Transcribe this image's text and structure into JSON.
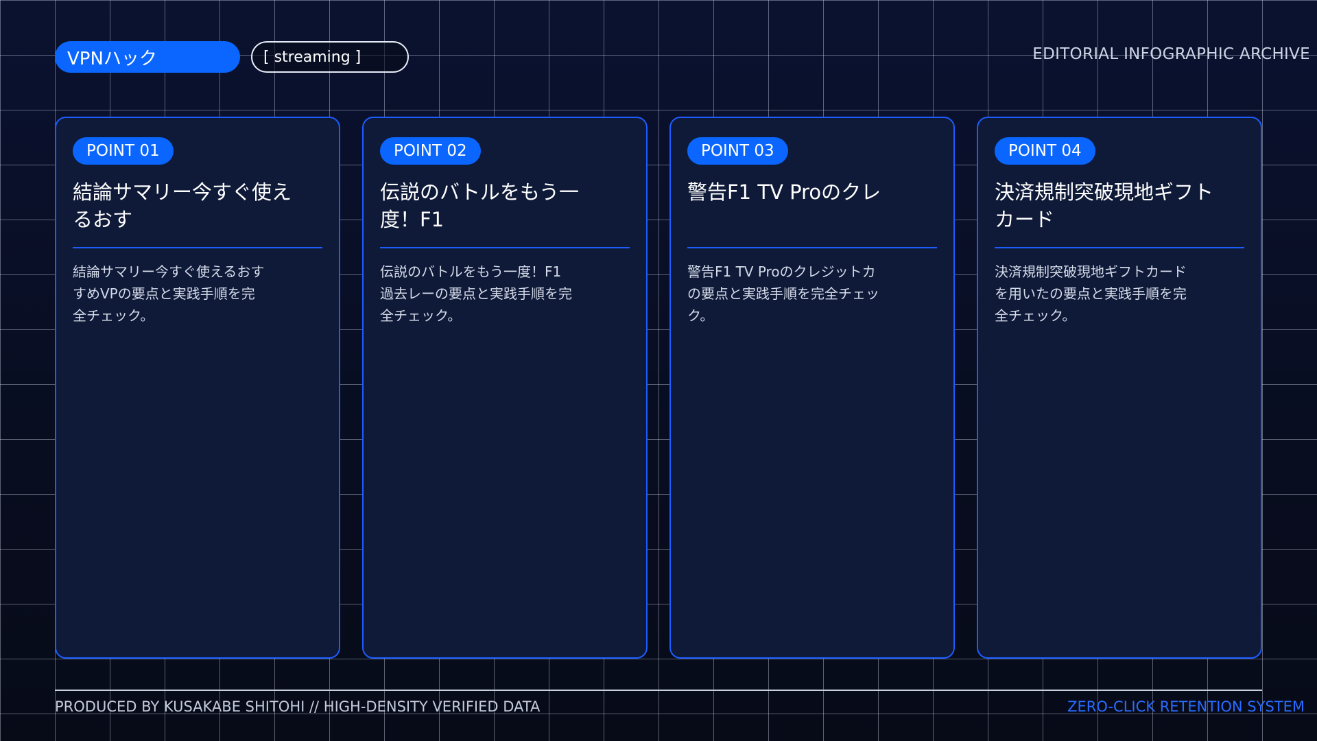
{
  "header": {
    "brand_label": "VPNハック",
    "tag_label": "[ streaming ]",
    "archive_label": "EDITORIAL INFOGRAPHIC ARCHIVE"
  },
  "cards": [
    {
      "point": "POINT 01",
      "title": "結論サマリー今すぐ使えるおす",
      "body": "結論サマリー今すぐ使えるおすすめVPの要点と実践手順を完全チェック。"
    },
    {
      "point": "POINT 02",
      "title": "伝説のバトルをもう一度！F1",
      "body": "伝説のバトルをもう一度！F1過去レーの要点と実践手順を完全チェック。"
    },
    {
      "point": "POINT 03",
      "title": "警告F1 TV Proのクレ",
      "body": "警告F1 TV Proのクレジットカの要点と実践手順を完全チェック。"
    },
    {
      "point": "POINT 04",
      "title": "決済規制突破現地ギフトカード",
      "body": "決済規制突破現地ギフトカードを用いたの要点と実践手順を完全チェック。"
    }
  ],
  "footer": {
    "left_text": "PRODUCED BY KUSAKABE SHITOHI // HIGH-DENSITY VERIFIED DATA",
    "right_text": "ZERO-CLICK RETENTION SYSTEM"
  },
  "colors": {
    "accent": "#0a66ff",
    "card_border": "#1d5cff",
    "card_bg": "#0f1a38",
    "page_bg": "#070c1a"
  }
}
